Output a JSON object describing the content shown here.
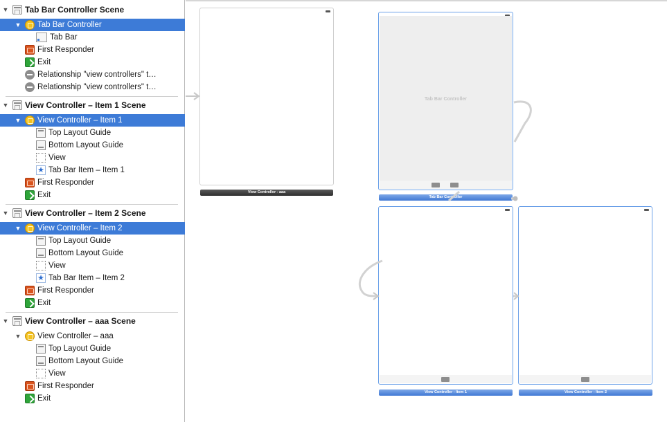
{
  "outline": {
    "scenes": [
      {
        "title": "Tab Bar Controller Scene",
        "controller": "Tab Bar Controller",
        "children": [
          "Tab Bar"
        ],
        "first_responder": "First Responder",
        "exit": "Exit",
        "relationships": [
          "Relationship \"view controllers\" t…",
          "Relationship \"view controllers\" t…"
        ]
      },
      {
        "title": "View Controller – Item 1 Scene",
        "controller": "View Controller – Item 1",
        "children": [
          "Top Layout Guide",
          "Bottom Layout Guide",
          "View",
          "Tab Bar Item – Item 1"
        ],
        "first_responder": "First Responder",
        "exit": "Exit"
      },
      {
        "title": "View Controller – Item 2 Scene",
        "controller": "View Controller – Item 2",
        "children": [
          "Top Layout Guide",
          "Bottom Layout Guide",
          "View",
          "Tab Bar Item – Item 2"
        ],
        "first_responder": "First Responder",
        "exit": "Exit"
      },
      {
        "title": "View Controller – aaa Scene",
        "controller": "View Controller – aaa",
        "children": [
          "Top Layout Guide",
          "Bottom Layout Guide",
          "View"
        ],
        "first_responder": "First Responder",
        "exit": "Exit"
      }
    ]
  },
  "canvas": {
    "tab_bar_controller_center": "Tab Bar Controller",
    "labels": {
      "aaa": "View Controller - aaa",
      "tab_bar_controller": "Tab Bar Controller",
      "item1": "View Controller - Item 1",
      "item2": "View Controller - Item 2"
    }
  },
  "colors": {
    "selection": "#3d7bd7",
    "scene_label_blue": "#3f78d4",
    "scene_label_dark": "#2e2e2e"
  }
}
